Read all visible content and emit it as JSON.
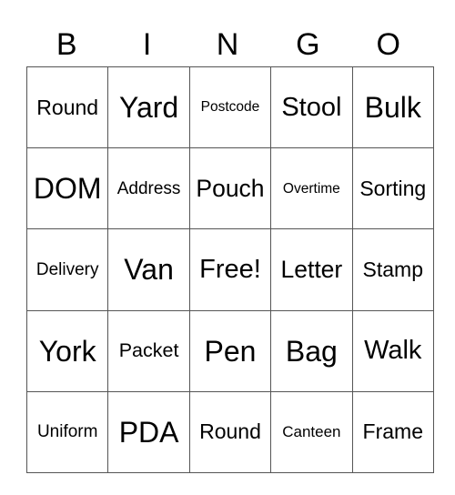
{
  "header": {
    "letters": [
      "B",
      "I",
      "N",
      "G",
      "O"
    ]
  },
  "grid": {
    "rows": [
      [
        "Round",
        "Yard",
        "Postcode",
        "Stool",
        "Bulk"
      ],
      [
        "DOM",
        "Address",
        "Pouch",
        "Overtime",
        "Sorting"
      ],
      [
        "Delivery",
        "Van",
        "Free!",
        "Letter",
        "Stamp"
      ],
      [
        "York",
        "Packet",
        "Pen",
        "Bag",
        "Walk"
      ],
      [
        "Uniform",
        "PDA",
        "Round",
        "Canteen",
        "Frame"
      ]
    ]
  }
}
